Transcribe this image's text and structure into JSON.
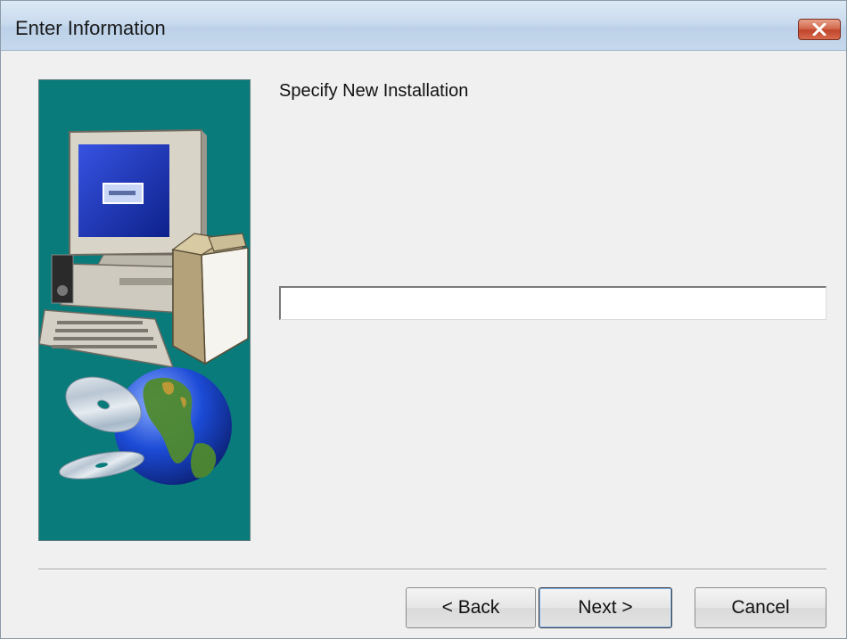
{
  "window": {
    "title": "Enter Information",
    "close_icon": "close-icon"
  },
  "art": {
    "description_icons": [
      "computer-icon",
      "software-box-icon",
      "cd-disc-icon",
      "globe-icon"
    ]
  },
  "form": {
    "prompt": "Specify New Installation",
    "input_value": "",
    "input_placeholder": ""
  },
  "buttons": {
    "back_label": "< Back",
    "next_label": "Next >",
    "cancel_label": "Cancel"
  },
  "colors": {
    "art_background": "#0a7b7b",
    "window_background": "#f0f0f0",
    "close_button": "#c0462a"
  }
}
